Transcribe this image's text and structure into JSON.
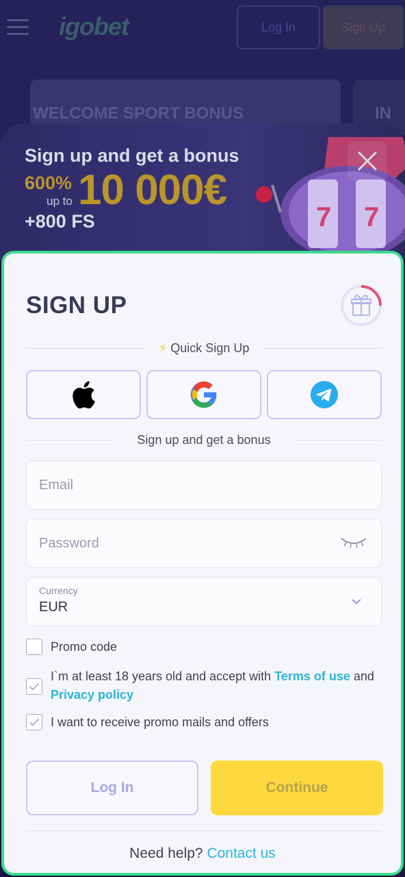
{
  "background": {
    "logo": "igobet",
    "login_label": "Log In",
    "signup_label": "Sign Up",
    "banner_text": "WELCOME SPORT BONUS",
    "banner2_text": "IN"
  },
  "bonus": {
    "title": "Sign up and get a bonus",
    "percent": "600%",
    "up_to": "up to",
    "amount": "10 000€",
    "free_spins": "+800 FS",
    "close_icon": "close-icon"
  },
  "form": {
    "title": "SIGN UP",
    "gift_icon": "gift-icon",
    "gift_progress": 0.25,
    "quick_signup": "Quick Sign Up",
    "social": [
      "apple-icon",
      "google-icon",
      "telegram-icon"
    ],
    "bonus_divider": "Sign up and get a bonus",
    "email_placeholder": "Email",
    "password_placeholder": "Password",
    "currency_label": "Currency",
    "currency_value": "EUR",
    "promo_label": "Promo code",
    "promo_checked": false,
    "age_text": "I`m at least 18 years old and accept with",
    "terms_link": "Terms of use",
    "and_text": "and",
    "privacy_link": "Privacy policy",
    "age_checked": true,
    "mails_text": "I want to receive promo mails and offers",
    "mails_checked": true,
    "login_button": "Log In",
    "continue_button": "Continue",
    "help_text": "Need help?",
    "contact_link": "Contact us"
  },
  "colors": {
    "accent": "#3cdc8e",
    "link": "#2bb5d6",
    "continue": "#fdd93d",
    "bonus_gold": "#b9952c"
  }
}
